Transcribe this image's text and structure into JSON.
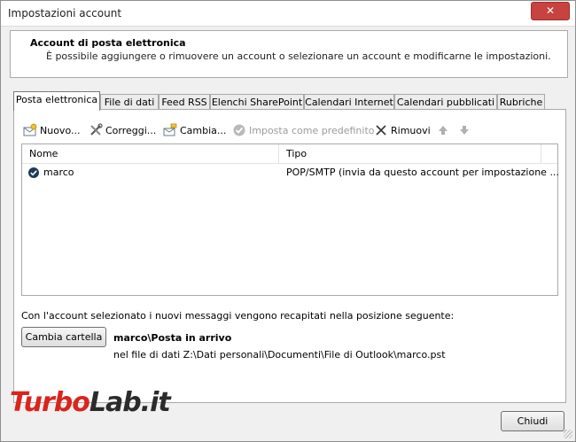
{
  "window": {
    "title": "Impostazioni account",
    "close_glyph": "✕"
  },
  "header": {
    "title": "Account di posta elettronica",
    "subtitle": "È possibile aggiungere o rimuovere un account o selezionare un account e modificarne le impostazioni."
  },
  "tabs": [
    {
      "label": "Posta elettronica",
      "active": true
    },
    {
      "label": "File di dati"
    },
    {
      "label": "Feed RSS"
    },
    {
      "label": "Elenchi SharePoint"
    },
    {
      "label": "Calendari Internet"
    },
    {
      "label": "Calendari pubblicati"
    },
    {
      "label": "Rubriche"
    }
  ],
  "toolbar": {
    "new_label": "Nuovo...",
    "repair_label": "Correggi...",
    "change_label": "Cambia...",
    "set_default_label": "Imposta come predefinito",
    "remove_label": "Rimuovi",
    "up_glyph": "🡅",
    "down_glyph": "🡇"
  },
  "list": {
    "columns": [
      "Nome",
      "Tipo"
    ],
    "rows": [
      {
        "name": "marco",
        "type": "POP/SMTP (invia da questo account per impostazione ..."
      }
    ]
  },
  "delivery": {
    "info": "Con l'account selezionato i nuovi messaggi vengono recapitati nella posizione seguente:",
    "change_folder_label": "Cambia cartella",
    "folder_name": "marco\\Posta in arrivo",
    "folder_path": "nel file di dati Z:\\Dati personali\\Documenti\\File di Outlook\\marco.pst"
  },
  "footer": {
    "close_label": "Chiudi"
  },
  "watermark": {
    "part1": "Turbo",
    "part2": "Lab.it"
  },
  "colors": {
    "accent_red": "#c7433f",
    "watermark_red": "#d9251d",
    "watermark_dark": "#2b2b2b"
  }
}
